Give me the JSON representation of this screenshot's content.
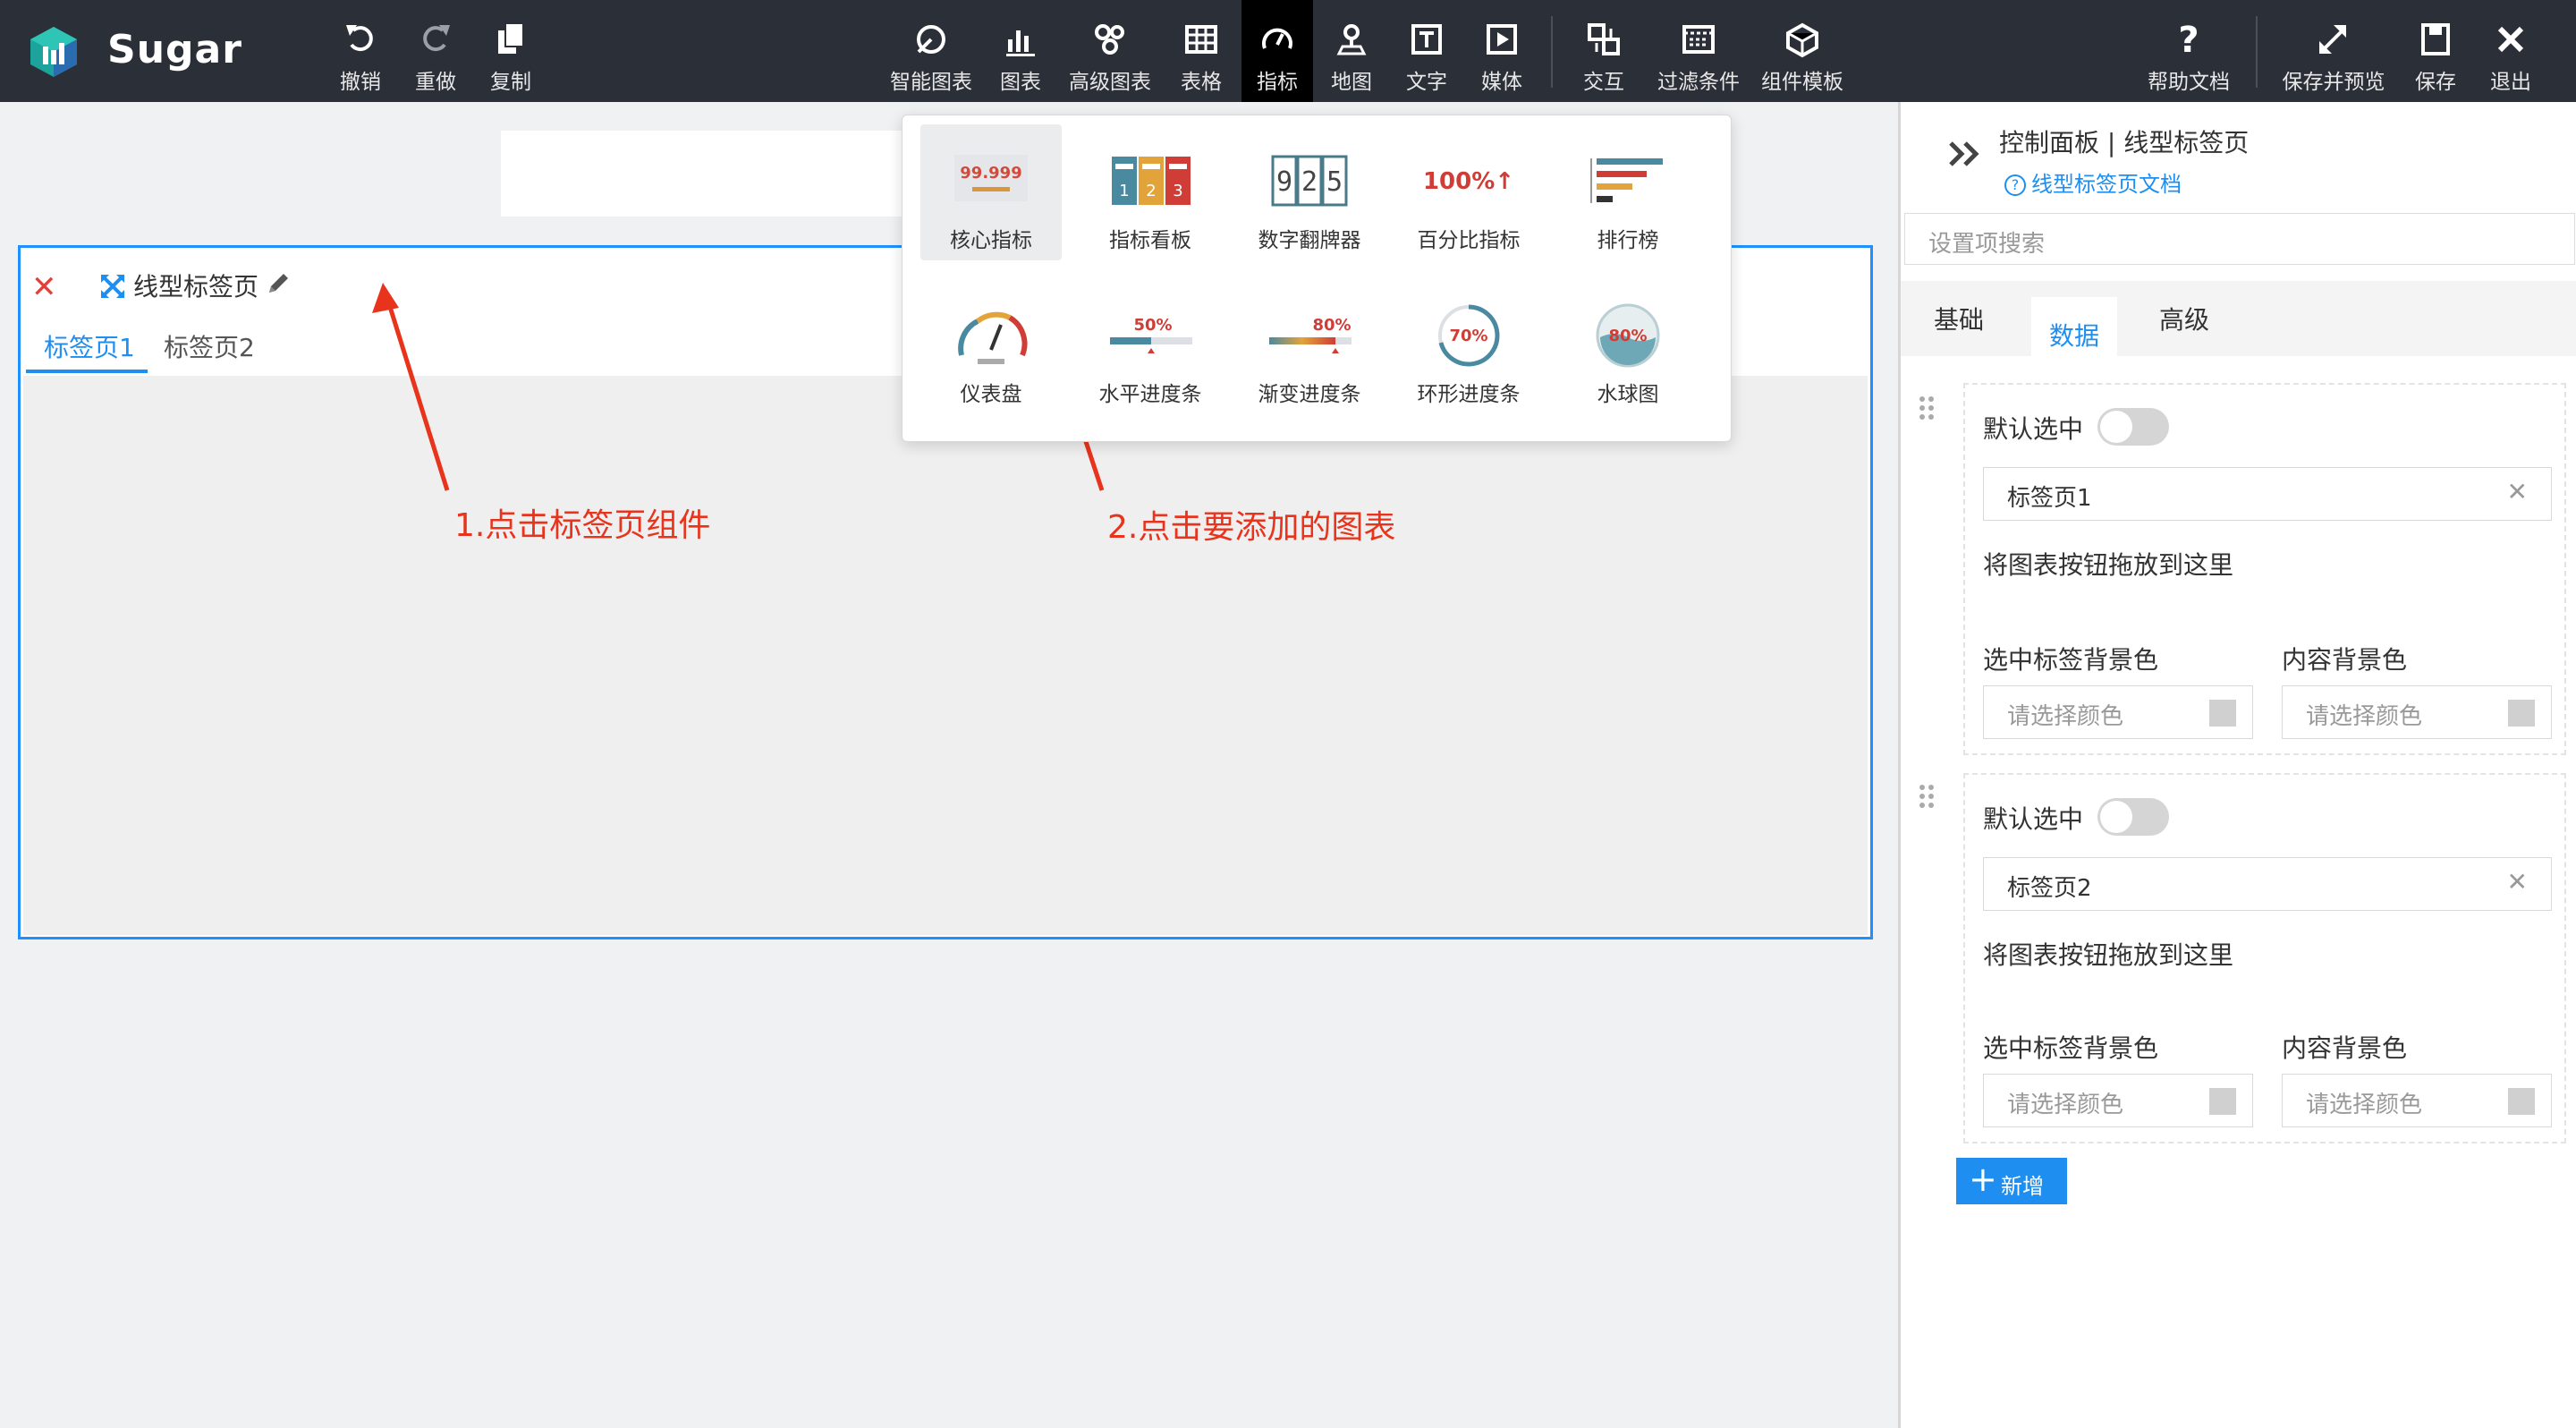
{
  "app": {
    "name": "Sugar"
  },
  "toolbar": {
    "left": [
      {
        "label": "撤销",
        "icon": "undo-icon"
      },
      {
        "label": "重做",
        "icon": "redo-icon"
      },
      {
        "label": "复制",
        "icon": "copy-icon"
      }
    ],
    "center": [
      {
        "label": "智能图表",
        "icon": "smart-chart-icon"
      },
      {
        "label": "图表",
        "icon": "bar-chart-icon"
      },
      {
        "label": "高级图表",
        "icon": "advanced-chart-icon"
      },
      {
        "label": "表格",
        "icon": "table-icon"
      },
      {
        "label": "指标",
        "icon": "gauge-icon"
      },
      {
        "label": "地图",
        "icon": "map-icon"
      },
      {
        "label": "文字",
        "icon": "text-icon"
      },
      {
        "label": "媒体",
        "icon": "media-icon"
      },
      {
        "label": "交互",
        "icon": "interaction-icon"
      },
      {
        "label": "过滤条件",
        "icon": "filter-icon"
      },
      {
        "label": "组件模板",
        "icon": "template-icon"
      }
    ],
    "right": [
      {
        "label": "帮助文档",
        "icon": "help-icon"
      },
      {
        "label": "保存并预览",
        "icon": "expand-icon"
      },
      {
        "label": "保存",
        "icon": "save-icon"
      },
      {
        "label": "退出",
        "icon": "exit-icon"
      }
    ]
  },
  "popup": {
    "items": [
      {
        "label": "核心指标",
        "icon": "core-metric-icon",
        "text": "99.999"
      },
      {
        "label": "指标看板",
        "icon": "metric-board-icon",
        "text": "123"
      },
      {
        "label": "数字翻牌器",
        "icon": "number-flipper-icon",
        "text": "925"
      },
      {
        "label": "百分比指标",
        "icon": "percent-metric-icon",
        "text": "100%↑"
      },
      {
        "label": "排行榜",
        "icon": "ranking-icon"
      },
      {
        "label": "仪表盘",
        "icon": "dashboard-gauge-icon"
      },
      {
        "label": "水平进度条",
        "icon": "horizontal-progress-icon",
        "text": "50%"
      },
      {
        "label": "渐变进度条",
        "icon": "gradient-progress-icon",
        "text": "80%"
      },
      {
        "label": "环形进度条",
        "icon": "ring-progress-icon",
        "text": "70%"
      },
      {
        "label": "水球图",
        "icon": "liquid-ball-icon",
        "text": "80%"
      }
    ]
  },
  "widget": {
    "title": "线型标签页",
    "tabs": [
      "标签页1",
      "标签页2"
    ]
  },
  "annotations": {
    "step1": "1.点击标签页组件",
    "step2": "2.点击要添加的图表"
  },
  "panel": {
    "title": "控制面板 | 线型标签页",
    "doc_link": "线型标签页文档",
    "search_placeholder": "设置项搜索",
    "tabs": [
      "基础",
      "数据",
      "高级"
    ],
    "active_tab": "数据",
    "cards": [
      {
        "default_label": "默认选中",
        "tab_value": "标签页1",
        "drop_hint": "将图表按钮拖放到这里",
        "selected_bg_label": "选中标签背景色",
        "content_bg_label": "内容背景色",
        "color_placeholder": "请选择颜色"
      },
      {
        "default_label": "默认选中",
        "tab_value": "标签页2",
        "drop_hint": "将图表按钮拖放到这里",
        "selected_bg_label": "选中标签背景色",
        "content_bg_label": "内容背景色",
        "color_placeholder": "请选择颜色"
      }
    ],
    "add_label": "新增"
  },
  "colors": {
    "accent": "#1e8ef0",
    "annotation": "#e8341c",
    "topbar": "#2b2f38"
  }
}
